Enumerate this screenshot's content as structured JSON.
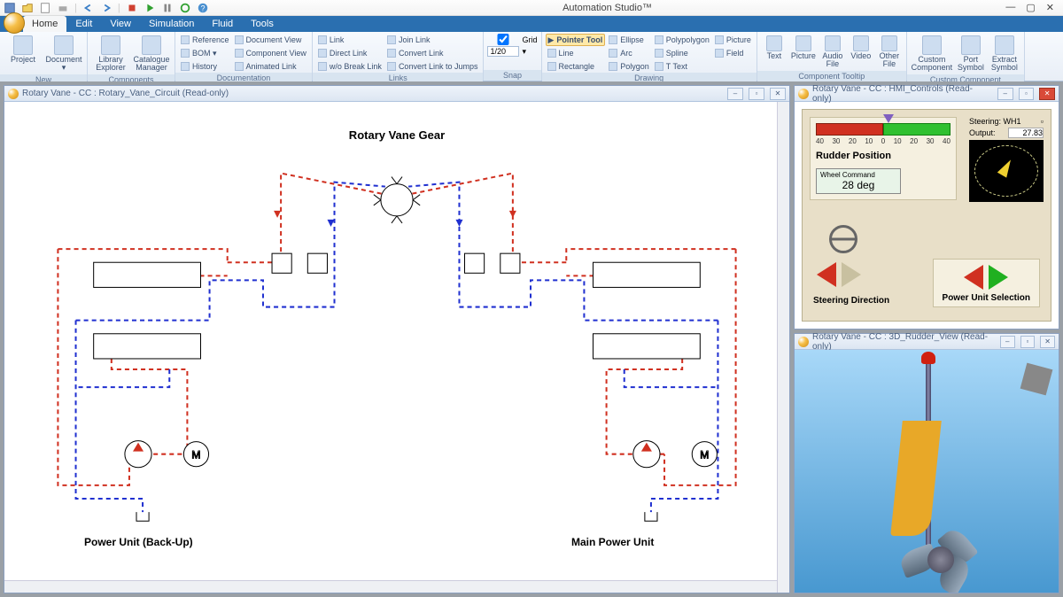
{
  "app": {
    "title": "Automation Studio™"
  },
  "tabs": [
    "Home",
    "Edit",
    "View",
    "Simulation",
    "Fluid",
    "Tools"
  ],
  "active_tab": "Home",
  "ribbon": {
    "new": {
      "label": "New",
      "project": "Project",
      "document": "Document"
    },
    "components": {
      "label": "Components",
      "library": "Library Explorer",
      "catalogue": "Catalogue Manager"
    },
    "documentation": {
      "label": "Documentation",
      "items": [
        "Reference",
        "Document View",
        "BOM ▾",
        "Component View",
        "History",
        "Animated Link"
      ]
    },
    "links": {
      "label": "Links",
      "items": [
        "Link",
        "Join Link",
        "Direct Link",
        "Convert Link",
        "Break Link",
        "Convert Link to Jumps",
        "w/o Break Link"
      ]
    },
    "snap": {
      "label": "Snap",
      "grid_label": "Grid",
      "grid_value": "1/20"
    },
    "drawing": {
      "label": "Drawing",
      "pointer": "Pointer Tool",
      "items": [
        "Ellipse",
        "Polypolygon",
        "Picture",
        "Line",
        "Arc",
        "Spline",
        "Field",
        "Rectangle",
        "Polygon",
        "T Text"
      ]
    },
    "tooltip": {
      "label": "Component Tooltip",
      "items": [
        "Text",
        "Picture",
        "Audio File",
        "Video",
        "Other File"
      ]
    },
    "custom": {
      "label": "Custom Component",
      "items": [
        "Custom Component",
        "Port Symbol",
        "Extract Symbol"
      ]
    }
  },
  "panels": {
    "circuit": {
      "title": "Rotary Vane - CC : Rotary_Vane_Circuit (Read-only)",
      "heading": "Rotary Vane Gear",
      "backup_label": "Power Unit (Back-Up)",
      "main_label": "Main Power Unit"
    },
    "hmi": {
      "title": "Rotary Vane - CC : HMI_Controls (Read-only)",
      "rudder_label": "Rudder Position",
      "scale": [
        "40",
        "30",
        "20",
        "10",
        "0",
        "10",
        "20",
        "30",
        "40"
      ],
      "wheel_cmd_label": "Wheel Command",
      "wheel_cmd_value": "28",
      "wheel_cmd_unit": "deg",
      "steering_label": "Steering: WH1",
      "output_label": "Output:",
      "output_value": "27.83",
      "steer_dir": "Steering Direction",
      "pu_sel": "Power Unit Selection"
    },
    "threed": {
      "title": "Rotary Vane - CC : 3D_Rudder_View (Read-only)"
    }
  }
}
